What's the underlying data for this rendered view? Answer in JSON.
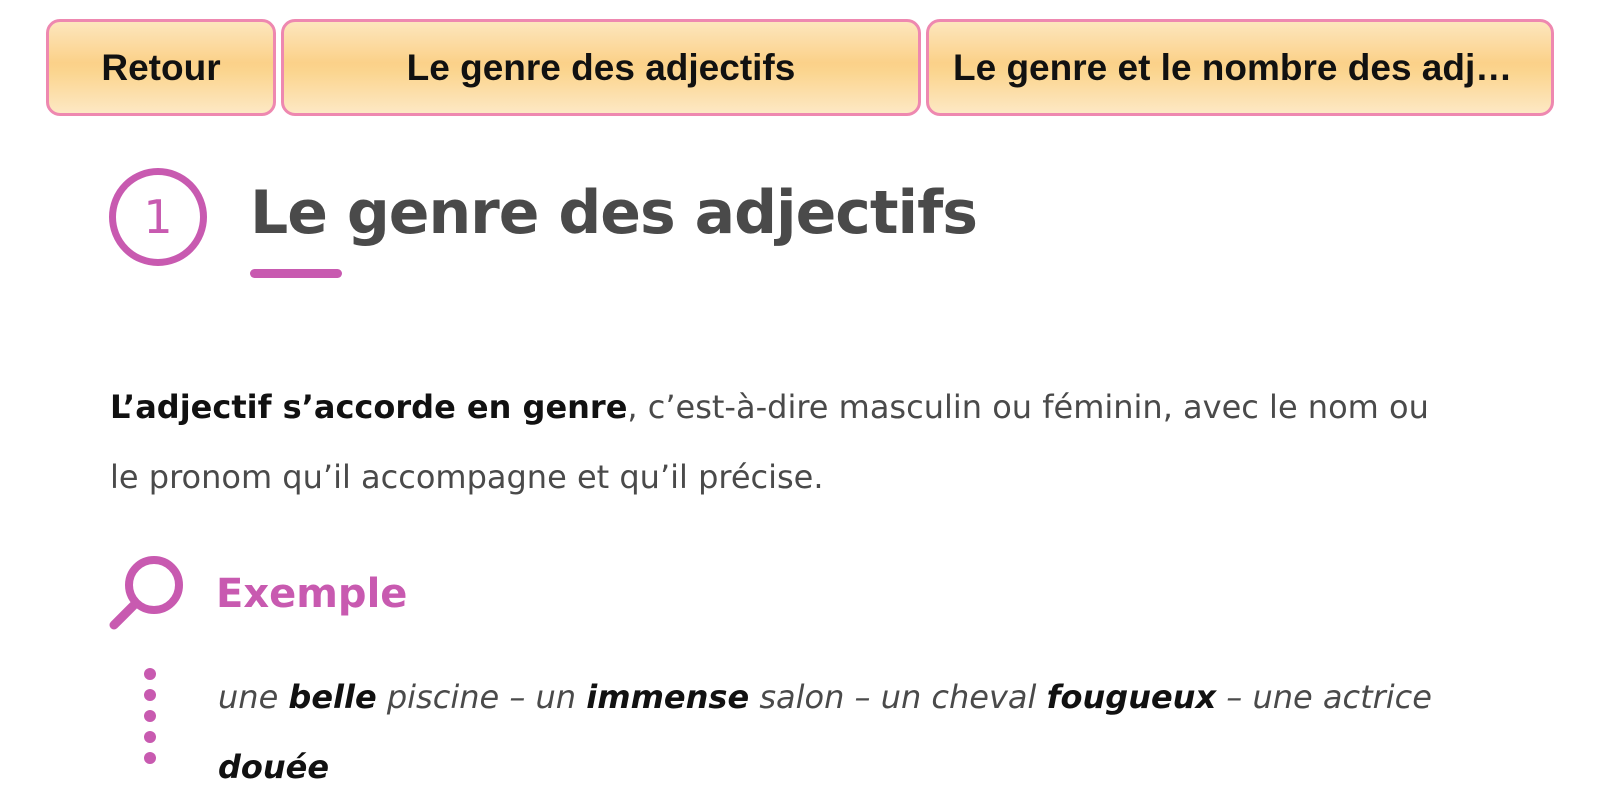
{
  "nav": {
    "back_label": "Retour",
    "tab1_label": "Le genre des adjectifs",
    "tab2_label": "Le genre et le nombre des adjectifs",
    "tab_border_color": "#ee88b0",
    "tab_fill_color": "#fbd189"
  },
  "section": {
    "number": "1",
    "title": "Le genre des adjectifs",
    "accent_color": "#c85ab0"
  },
  "intro": {
    "bold": "L’adjectif s’accorde en genre",
    "rest": ", c’est-à-dire masculin ou féminin, avec le nom ou le pronom qu’il accompagne et qu’il précise."
  },
  "example": {
    "icon": "magnifier-icon",
    "label": "Exemple",
    "parts": [
      {
        "text": "une ",
        "bold": false
      },
      {
        "text": "belle",
        "bold": true
      },
      {
        "text": " piscine – un ",
        "bold": false
      },
      {
        "text": "immense",
        "bold": true
      },
      {
        "text": " salon – un cheval ",
        "bold": false
      },
      {
        "text": "fougueux",
        "bold": true
      },
      {
        "text": " – une actrice ",
        "bold": false
      },
      {
        "text": "douée",
        "bold": true
      }
    ]
  }
}
